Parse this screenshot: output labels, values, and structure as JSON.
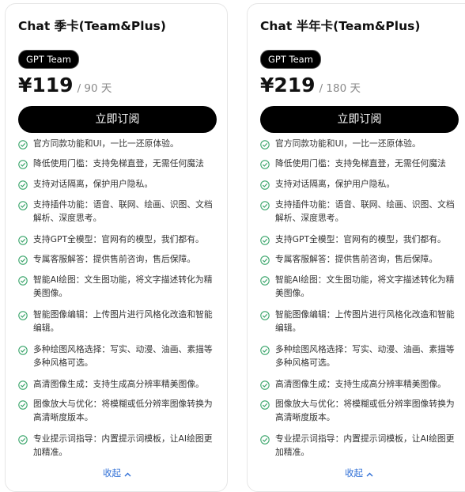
{
  "colors": {
    "accent_link": "#2f6fd6",
    "check_green": "#3aa56b",
    "button_bg": "#000000"
  },
  "plans": [
    {
      "title": "Chat 季卡(Team&Plus)",
      "badge": "GPT Team",
      "price": "¥119",
      "period": "/ 90 天",
      "subscribe_label": "立即订阅",
      "collapse_label": "收起",
      "features": [
        "官方同款功能和UI，一比一还原体验。",
        "降低使用门槛：支持免梯直登，无需任何魔法",
        "支持对话隔离，保护用户隐私。",
        "支持插件功能：语音、联网、绘画、识图、文档解析、深度思考。",
        "支持GPT全模型：官网有的模型，我们都有。",
        "专属客服解答：提供售前咨询，售后保障。",
        "智能AI绘图：文生图功能，将文字描述转化为精美图像。",
        "智能图像编辑：上传图片进行风格化改造和智能编辑。",
        "多种绘图风格选择：写实、动漫、油画、素描等多种风格可选。",
        "高清图像生成：支持生成高分辨率精美图像。",
        "图像放大与优化：将模糊或低分辨率图像转换为高清晰度版本。",
        "专业提示词指导：内置提示词模板，让AI绘图更加精准。"
      ]
    },
    {
      "title": "Chat 半年卡(Team&Plus)",
      "badge": "GPT Team",
      "price": "¥219",
      "period": "/ 180 天",
      "subscribe_label": "立即订阅",
      "collapse_label": "收起",
      "features": [
        "官方同款功能和UI，一比一还原体验。",
        "降低使用门槛：支持免梯直登，无需任何魔法",
        "支持对话隔离，保护用户隐私。",
        "支持插件功能：语音、联网、绘画、识图、文档解析、深度思考。",
        "支持GPT全模型：官网有的模型，我们都有。",
        "专属客服解答：提供售前咨询，售后保障。",
        "智能AI绘图：文生图功能，将文字描述转化为精美图像。",
        "智能图像编辑：上传图片进行风格化改造和智能编辑。",
        "多种绘图风格选择：写实、动漫、油画、素描等多种风格可选。",
        "高清图像生成：支持生成高分辨率精美图像。",
        "图像放大与优化：将模糊或低分辨率图像转换为高清晰度版本。",
        "专业提示词指导：内置提示词模板，让AI绘图更加精准。"
      ]
    }
  ]
}
